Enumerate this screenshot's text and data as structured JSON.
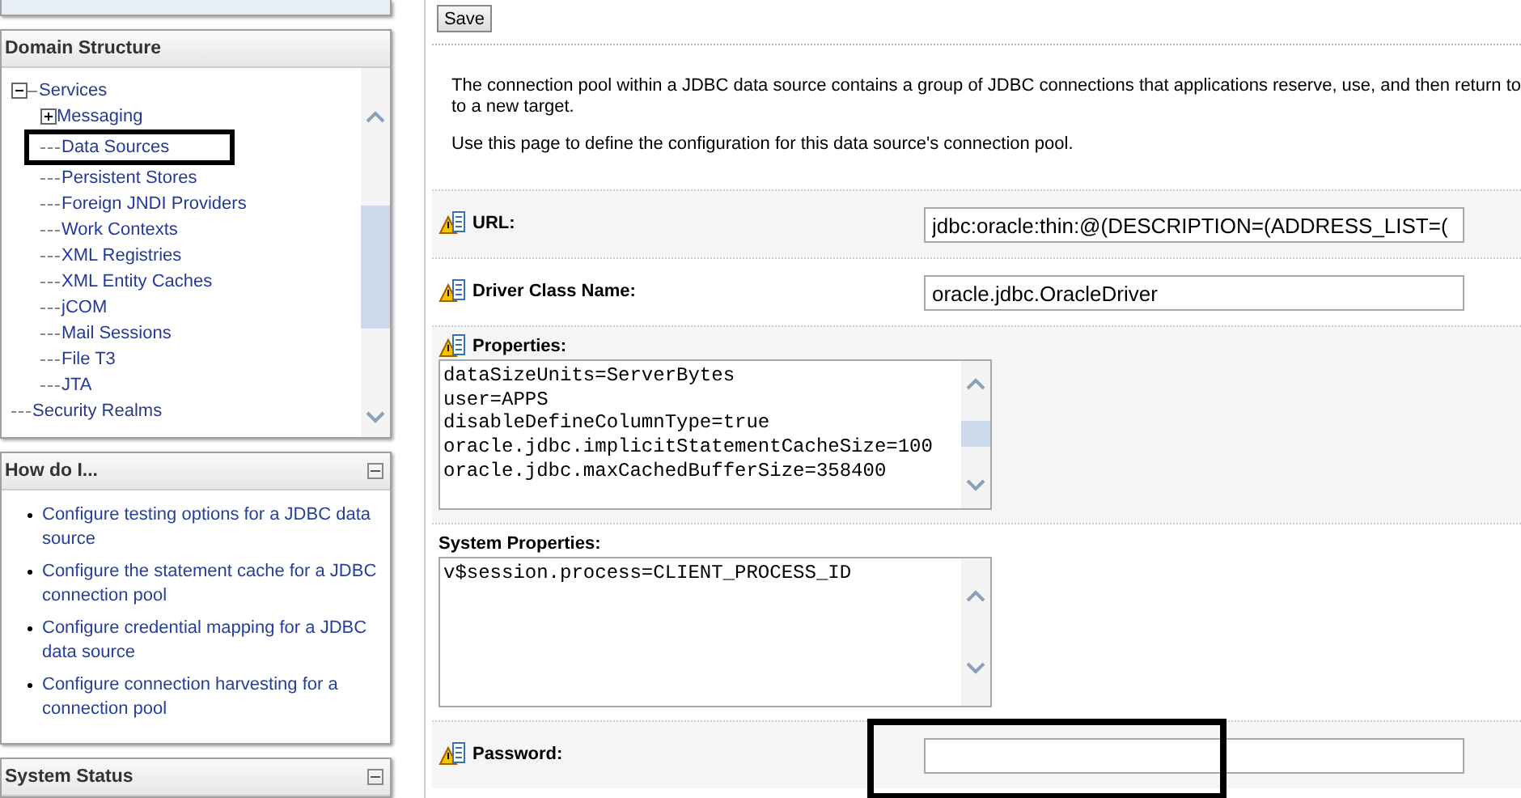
{
  "domain_structure": {
    "title": "Domain Structure",
    "tree": [
      {
        "label": "Services",
        "expanded": true,
        "children": [
          {
            "label": "Messaging",
            "expanded": false
          },
          {
            "label": "Data Sources",
            "highlighted": true
          },
          {
            "label": "Persistent Stores"
          },
          {
            "label": "Foreign JNDI Providers"
          },
          {
            "label": "Work Contexts"
          },
          {
            "label": "XML Registries"
          },
          {
            "label": "XML Entity Caches"
          },
          {
            "label": "jCOM"
          },
          {
            "label": "Mail Sessions"
          },
          {
            "label": "File T3"
          },
          {
            "label": "JTA"
          }
        ]
      },
      {
        "label": "Security Realms"
      }
    ]
  },
  "how_do_i": {
    "title": "How do I...",
    "links": [
      "Configure testing options for a JDBC data source",
      "Configure the statement cache for a JDBC connection pool",
      "Configure credential mapping for a JDBC data source",
      "Configure connection harvesting for a connection pool"
    ]
  },
  "system_status": {
    "title": "System Status"
  },
  "save_button": "Save",
  "intro": [
    [
      "The connection pool within a JDBC data source contains a group of JDBC connections that applications reserve, use, and then return to",
      "to a new target."
    ],
    [
      "Use this page to define the configuration for this data source's connection pool."
    ]
  ],
  "fields": [
    {
      "kind": "input",
      "label": "URL:",
      "value": "jdbc:oracle:thin:@(DESCRIPTION=(ADDRESS_LIST=(",
      "help_icon": true
    },
    {
      "kind": "input",
      "label": "Driver Class Name:",
      "value": "oracle.jdbc.OracleDriver",
      "help_icon": true
    },
    {
      "kind": "textarea",
      "label": "Properties:",
      "lines": [
        "dataSizeUnits=ServerBytes",
        "user=APPS",
        "disableDefineColumnType=true",
        "oracle.jdbc.implicitStatementCacheSize=100",
        "oracle.jdbc.maxCachedBufferSize=358400"
      ],
      "help_icon": true
    },
    {
      "kind": "textarea",
      "label": "System Properties:",
      "lines": [
        "v$session.process=CLIENT_PROCESS_ID"
      ],
      "help_icon": false
    },
    {
      "kind": "input",
      "label": "Password:",
      "help_icon": true,
      "highlighted": true
    }
  ]
}
